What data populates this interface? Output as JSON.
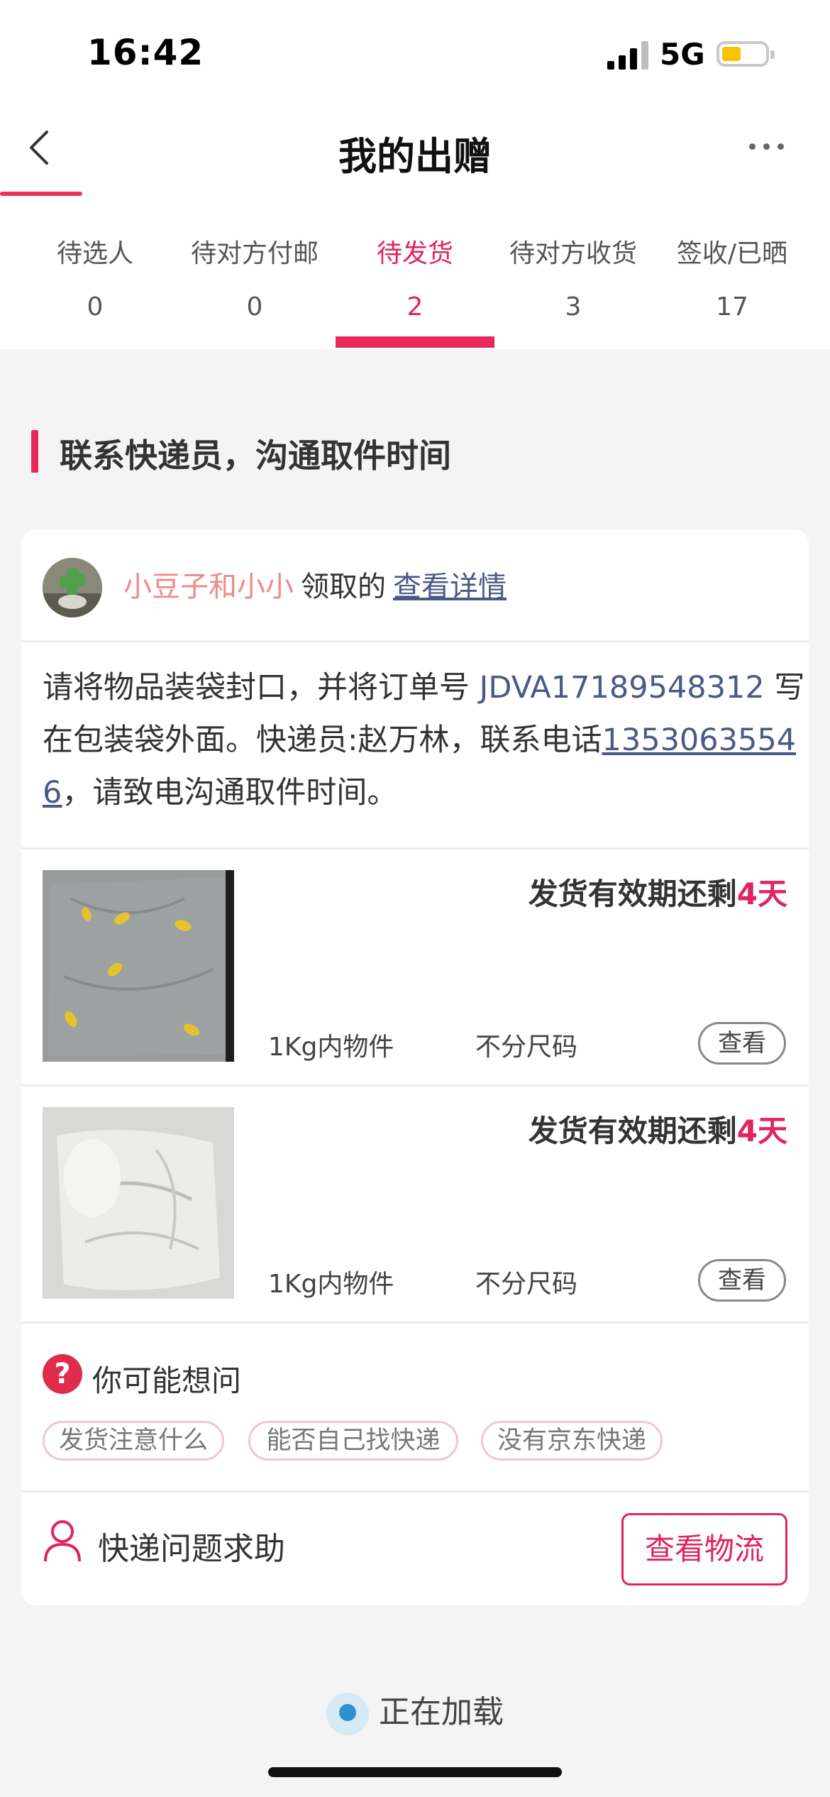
{
  "status_bar": {
    "time": "16:42",
    "network": "5G"
  },
  "nav": {
    "title": "我的出赠"
  },
  "tabs": [
    {
      "label": "待选人",
      "count": "0"
    },
    {
      "label": "待对方付邮",
      "count": "0"
    },
    {
      "label": "待发货",
      "count": "2"
    },
    {
      "label": "待对方收货",
      "count": "3"
    },
    {
      "label": "签收/已晒",
      "count": "17"
    }
  ],
  "active_tab": 2,
  "section": {
    "title": "联系快递员，沟通取件时间"
  },
  "order": {
    "claimant": "小豆子和小小",
    "claim_text": "领取的",
    "details_link": "查看详情",
    "instruction_prefix": "请将物品装袋封口，并将订单号 ",
    "order_number": "JDVA17189548312",
    "instruction_middle": " 写在包装袋外面。快递员:赵万林，联系电话",
    "phone": "13530635546",
    "instruction_suffix": "，请致电沟通取件时间。"
  },
  "items": [
    {
      "deadline_prefix": "发货有效期还剩",
      "deadline_days": "4天",
      "weight": "1Kg内物件",
      "size": "不分尺码",
      "view_label": "查看"
    },
    {
      "deadline_prefix": "发货有效期还剩",
      "deadline_days": "4天",
      "weight": "1Kg内物件",
      "size": "不分尺码",
      "view_label": "查看"
    }
  ],
  "faq": {
    "title": "你可能想问",
    "chips": [
      "发货注意什么",
      "能否自己找快递",
      "没有京东快递"
    ]
  },
  "help": {
    "label": "快递问题求助",
    "logistics_button": "查看物流"
  },
  "loading_text": "正在加载",
  "colors": {
    "accent": "#e0245e",
    "link": "#4a5a86",
    "claimant": "#ef8a8a"
  }
}
